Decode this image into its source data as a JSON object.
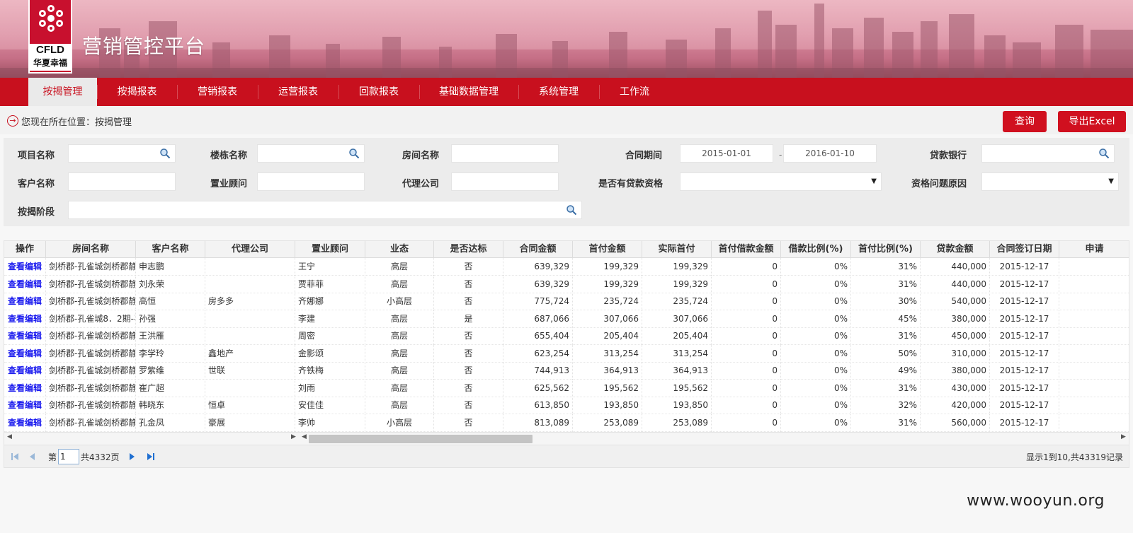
{
  "header": {
    "logo_en": "CFLD",
    "logo_cn": "华夏幸福",
    "title": "营销管控平台"
  },
  "nav": [
    "按揭管理",
    "按揭报表",
    "营销报表",
    "运营报表",
    "回款报表",
    "基础数据管理",
    "系统管理",
    "工作流"
  ],
  "breadcrumb": {
    "text": "您现在所在位置：按揭管理"
  },
  "buttons": {
    "query": "查询",
    "export": "导出Excel"
  },
  "filters": {
    "project_name": "项目名称",
    "building_name": "楼栋名称",
    "room_name": "房间名称",
    "contract_period": "合同期间",
    "date_start": "2015-01-01",
    "date_sep": "-",
    "date_end": "2016-01-10",
    "loan_bank": "贷款银行",
    "customer_name": "客户名称",
    "consultant": "置业顾问",
    "agency": "代理公司",
    "loan_eligible": "是否有贷款资格",
    "eligibility_reason": "资格问题原因",
    "mortgage_stage": "按揭阶段"
  },
  "grid": {
    "columns": [
      "操作",
      "房间名称",
      "客户名称",
      "代理公司",
      "置业顾问",
      "业态",
      "是否达标",
      "合同金额",
      "首付金额",
      "实际首付",
      "首付借款金额",
      "借款比例(%)",
      "首付比例(%)",
      "贷款金额",
      "合同签订日期",
      "申请"
    ],
    "op_view": "查看",
    "op_edit": "编辑",
    "rows": [
      [
        "剑桥郡-孔雀城剑桥郡静",
        "申志鹏",
        "",
        "王宁",
        "高层",
        "否",
        "639,329",
        "199,329",
        "199,329",
        "0",
        "0%",
        "31%",
        "440,000",
        "2015-12-17"
      ],
      [
        "剑桥郡-孔雀城剑桥郡静",
        "刘永荣",
        "",
        "贾菲菲",
        "高层",
        "否",
        "639,329",
        "199,329",
        "199,329",
        "0",
        "0%",
        "31%",
        "440,000",
        "2015-12-17"
      ],
      [
        "剑桥郡-孔雀城剑桥郡静",
        "高恒",
        "房多多",
        "齐娜娜",
        "小高层",
        "否",
        "775,724",
        "235,724",
        "235,724",
        "0",
        "0%",
        "30%",
        "540,000",
        "2015-12-17"
      ],
      [
        "剑桥郡-孔雀城8．2期-孑",
        "孙强",
        "",
        "李建",
        "高层",
        "是",
        "687,066",
        "307,066",
        "307,066",
        "0",
        "0%",
        "45%",
        "380,000",
        "2015-12-17"
      ],
      [
        "剑桥郡-孔雀城剑桥郡静",
        "王洪雁",
        "",
        "周密",
        "高层",
        "否",
        "655,404",
        "205,404",
        "205,404",
        "0",
        "0%",
        "31%",
        "450,000",
        "2015-12-17"
      ],
      [
        "剑桥郡-孔雀城剑桥郡静",
        "李学玲",
        "鑫地产",
        "金影颂",
        "高层",
        "否",
        "623,254",
        "313,254",
        "313,254",
        "0",
        "0%",
        "50%",
        "310,000",
        "2015-12-17"
      ],
      [
        "剑桥郡-孔雀城剑桥郡静",
        "罗紫维",
        "世联",
        "齐铁梅",
        "高层",
        "否",
        "744,913",
        "364,913",
        "364,913",
        "0",
        "0%",
        "49%",
        "380,000",
        "2015-12-17"
      ],
      [
        "剑桥郡-孔雀城剑桥郡静",
        "崔广超",
        "",
        "刘雨",
        "高层",
        "否",
        "625,562",
        "195,562",
        "195,562",
        "0",
        "0%",
        "31%",
        "430,000",
        "2015-12-17"
      ],
      [
        "剑桥郡-孔雀城剑桥郡静",
        "韩晓东",
        "恒卓",
        "安佳佳",
        "高层",
        "否",
        "613,850",
        "193,850",
        "193,850",
        "0",
        "0%",
        "32%",
        "420,000",
        "2015-12-17"
      ],
      [
        "剑桥郡-孔雀城剑桥郡静",
        "孔金凤",
        "豪展",
        "李帅",
        "小高层",
        "否",
        "813,089",
        "253,089",
        "253,089",
        "0",
        "0%",
        "31%",
        "560,000",
        "2015-12-17"
      ]
    ]
  },
  "pager": {
    "page_prefix": "第",
    "page_value": "1",
    "page_total": "共4332页",
    "summary": "显示1到10,共43319记录"
  },
  "watermark": "www.wooyun.org",
  "colors": {
    "brand_red": "#c8101e",
    "link_blue": "#1a1aee"
  }
}
